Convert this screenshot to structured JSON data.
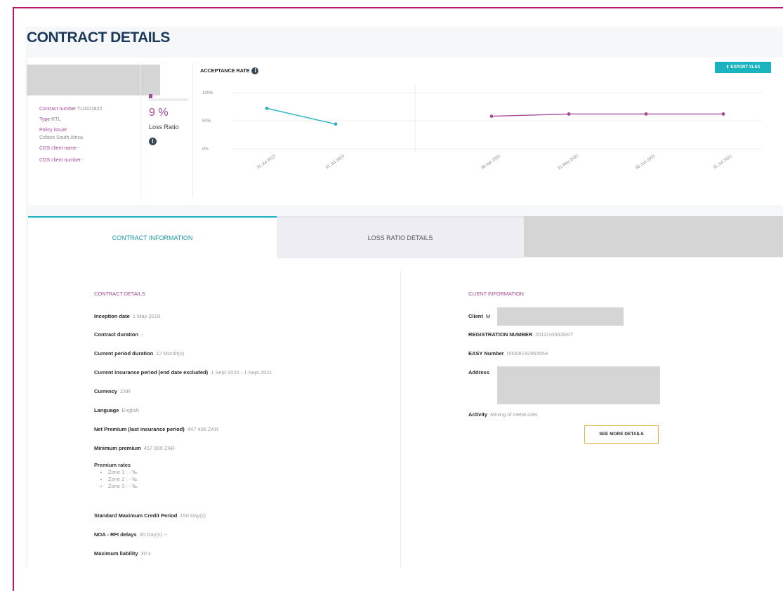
{
  "page": {
    "title": "CONTRACT DETAILS"
  },
  "summary": {
    "contract_number_label": "Contract number",
    "contract_number_value": "TL0101822",
    "type_label": "Type",
    "type_value": "RTL",
    "policy_issuer_label": "Policy issuer",
    "policy_issuer_value": "Coface South Africa",
    "cgs_client_name_label": "CGS client name",
    "cgs_client_name_value": "-",
    "cgs_client_number_label": "CGS client number",
    "cgs_client_number_value": "-"
  },
  "loss_ratio": {
    "value_text": "9 %",
    "label": "Loss Ratio",
    "info_icon": "info-icon",
    "fill_fraction": 0.09
  },
  "acceptance": {
    "title": "ACCEPTANCE RATE",
    "export_label": "EXPORT XLSX",
    "export_icon": "upload-icon"
  },
  "chart_data": {
    "type": "line",
    "title": "ACCEPTANCE RATE",
    "y_ticks": [
      "100%",
      "50%",
      "0%"
    ],
    "ylim": [
      0,
      100
    ],
    "x_ticks": [
      "31 Jul 2019",
      "31 Jul 2020",
      "30 Apr 2021",
      "31 May 2021",
      "30 Jun 2021",
      "31 Jul 2021"
    ],
    "series": [
      {
        "color": "#2bb5c2",
        "x": [
          "31 Jul 2019",
          "31 Jul 2020"
        ],
        "values": [
          72,
          44
        ]
      },
      {
        "color": "#a64b97",
        "x": [
          "30 Apr 2021",
          "31 May 2021",
          "30 Jun 2021",
          "31 Jul 2021"
        ],
        "values": [
          58,
          62,
          62,
          62
        ]
      }
    ],
    "grid": true
  },
  "tabs": [
    {
      "label": "CONTRACT INFORMATION",
      "active": true
    },
    {
      "label": "LOSS RATIO DETAILS",
      "active": false
    }
  ],
  "contract_details": {
    "title": "CONTRACT DETAILS",
    "fields": [
      {
        "label": "Inception date",
        "value": "1 May 2019"
      },
      {
        "label": "Contract duration",
        "value": "-"
      },
      {
        "label": "Current period duration",
        "value": "12 Month(s)"
      },
      {
        "label": "Current insurance period (end date excluded)",
        "value": "1 Sept 2020 - 1 Sept 2021"
      },
      {
        "label": "Currency",
        "value": "ZAR"
      },
      {
        "label": "Language",
        "value": "English"
      },
      {
        "label": "Net Premium (last insurance period)",
        "value": "447 406 ZAR"
      },
      {
        "label": "Minimum premium",
        "value": "457 600 ZAR"
      }
    ],
    "premium_rates_label": "Premium rates",
    "premium_rates": [
      "Zone 1 : - ‰",
      "Zone 2 : - ‰",
      "Zone 3 : - ‰"
    ],
    "fields_after": [
      {
        "label": "Standard Maximum Credit Period",
        "value": "150 Day(s)"
      },
      {
        "label": "NOA - RFI delays",
        "value": "30 Day(s) --"
      },
      {
        "label": "Maximum liability",
        "value": "30 x"
      }
    ]
  },
  "client_info": {
    "title": "CLIENT INFORMATION",
    "client_label": "Client",
    "client_value": "M",
    "registration_label": "REGISTRATION NUMBER",
    "registration_value": "2012/105626/07",
    "easy_label": "EASY Number",
    "easy_value": "00008192864554",
    "address_label": "Address",
    "activity_label": "Activity",
    "activity_value": "Mining of metal ores",
    "more_button": "SEE MORE DETAILS"
  }
}
